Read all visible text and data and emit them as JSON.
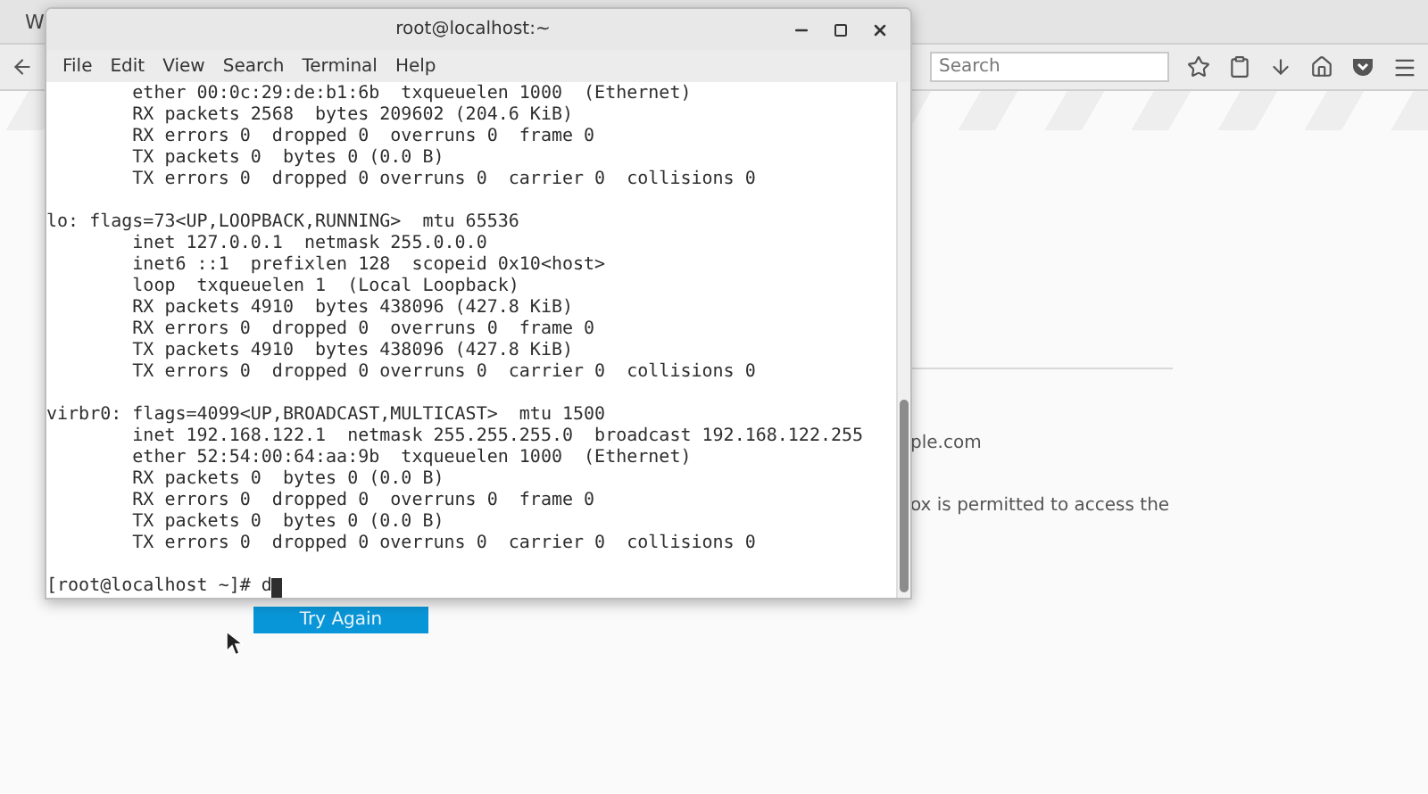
{
  "browser": {
    "tab": {
      "label": "W"
    },
    "search": {
      "placeholder": "Search"
    },
    "page": {
      "button": "Try Again",
      "fragments": [
        "ple.com",
        "ox is permitted to access the"
      ]
    }
  },
  "terminal": {
    "title": "root@localhost:~",
    "menu": [
      "File",
      "Edit",
      "View",
      "Search",
      "Terminal",
      "Help"
    ],
    "blocks": [
      [
        "        ether 00:0c:29:de:b1:6b  txqueuelen 1000  (Ethernet)",
        "        RX packets 2568  bytes 209602 (204.6 KiB)",
        "        RX errors 0  dropped 0  overruns 0  frame 0",
        "        TX packets 0  bytes 0 (0.0 B)",
        "        TX errors 0  dropped 0 overruns 0  carrier 0  collisions 0"
      ],
      [
        "lo: flags=73<UP,LOOPBACK,RUNNING>  mtu 65536",
        "        inet 127.0.0.1  netmask 255.0.0.0",
        "        inet6 ::1  prefixlen 128  scopeid 0x10<host>",
        "        loop  txqueuelen 1  (Local Loopback)",
        "        RX packets 4910  bytes 438096 (427.8 KiB)",
        "        RX errors 0  dropped 0  overruns 0  frame 0",
        "        TX packets 4910  bytes 438096 (427.8 KiB)",
        "        TX errors 0  dropped 0 overruns 0  carrier 0  collisions 0"
      ],
      [
        "virbr0: flags=4099<UP,BROADCAST,MULTICAST>  mtu 1500",
        "        inet 192.168.122.1  netmask 255.255.255.0  broadcast 192.168.122.255",
        "        ether 52:54:00:64:aa:9b  txqueuelen 1000  (Ethernet)",
        "        RX packets 0  bytes 0 (0.0 B)",
        "        RX errors 0  dropped 0  overruns 0  frame 0",
        "        TX packets 0  bytes 0 (0.0 B)",
        "        TX errors 0  dropped 0 overruns 0  carrier 0  collisions 0"
      ]
    ],
    "prompt": "[root@localhost ~]# d"
  }
}
